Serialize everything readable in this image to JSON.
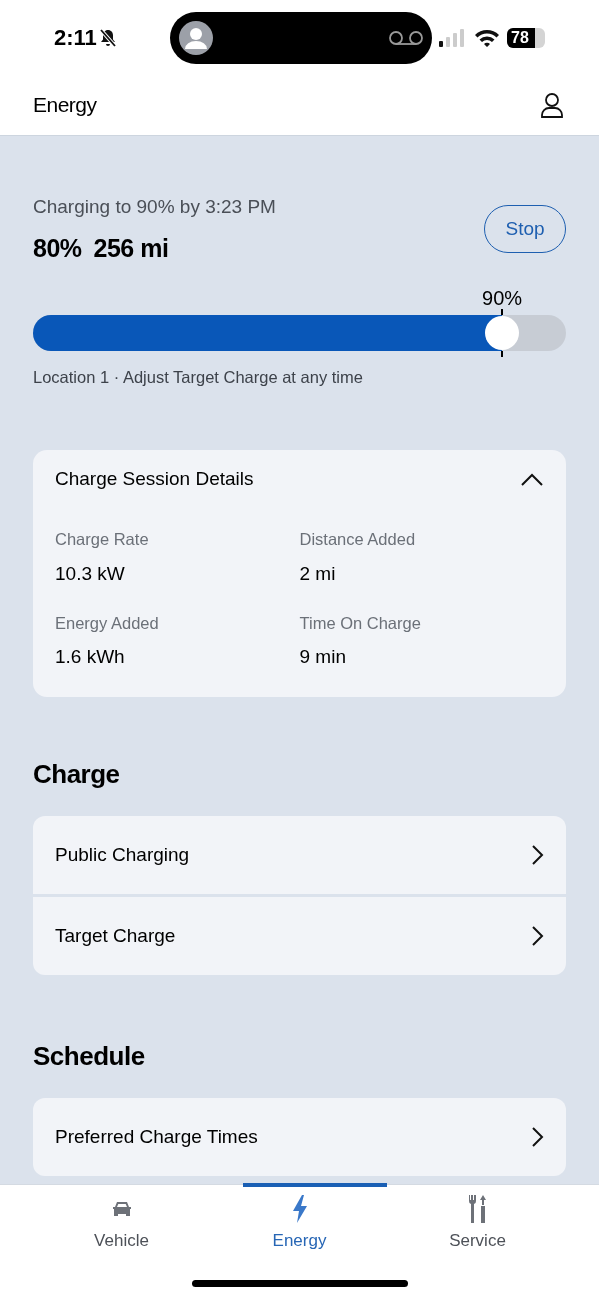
{
  "status_bar": {
    "time": "2:11",
    "silent": true,
    "battery": "78"
  },
  "header": {
    "title": "Energy"
  },
  "charging": {
    "status": "Charging to 90% by 3:23 PM",
    "charge": "80%",
    "range": "256 mi",
    "stop_button": "Stop",
    "target_label": "90%",
    "level": 0.88,
    "note": "Location 1 · Adjust Target Charge at any time"
  },
  "session_details": {
    "title": "Charge Session Details",
    "expanded": true,
    "items": [
      {
        "label": "Charge Rate",
        "value": "10.3 kW"
      },
      {
        "label": "Distance Added",
        "value": "2 mi"
      },
      {
        "label": "Energy Added",
        "value": "1.6 kWh"
      },
      {
        "label": "Time On Charge",
        "value": "9 min"
      }
    ]
  },
  "sections": [
    {
      "title": "Charge",
      "items": [
        "Public Charging",
        "Target Charge"
      ]
    },
    {
      "title": "Schedule",
      "items": [
        "Preferred Charge Times"
      ]
    }
  ],
  "tab_bar": [
    {
      "kind": "car",
      "label": "Vehicle",
      "selected": false
    },
    {
      "kind": "bolt",
      "label": "Energy",
      "selected": true
    },
    {
      "kind": "tools",
      "label": "Service",
      "selected": false
    }
  ]
}
